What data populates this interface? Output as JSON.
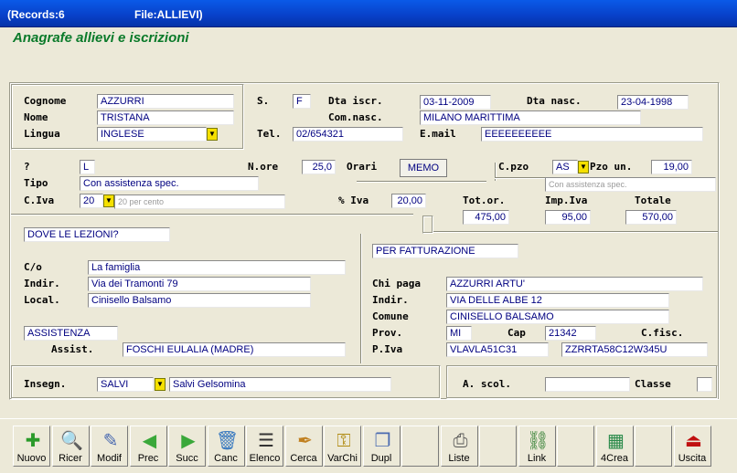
{
  "titlebar": {
    "records": "(Records:6",
    "file": "File:ALLIEVI)"
  },
  "form": {
    "title": "Anagrafe allievi e iscrizioni"
  },
  "labels": {
    "cognome": "Cognome",
    "nome": "Nome",
    "lingua": "Lingua",
    "s": "S.",
    "dta_iscr": "Dta iscr.",
    "dta_nasc": "Dta nasc.",
    "com_nasc": "Com.nasc.",
    "tel": "Tel.",
    "email": "E.mail",
    "q": "?",
    "n_ore": "N.ore",
    "orari": "Orari",
    "c_pzo": "C.pzo",
    "pzo_un": "Pzo un.",
    "tipo": "Tipo",
    "c_iva": "C.Iva",
    "perc_iva": "% Iva",
    "tot_or": "Tot.or.",
    "imp_iva": "Imp.Iva",
    "totale": "Totale",
    "co": "C/o",
    "indir": "Indir.",
    "local": "Local.",
    "assist": "Assist.",
    "chi_paga": "Chi paga",
    "indir2": "Indir.",
    "comune": "Comune",
    "prov": "Prov.",
    "cap": "Cap",
    "c_fisc": "C.fisc.",
    "p_iva": "P.Iva",
    "insegn": "Insegn.",
    "a_scol": "A. scol.",
    "classe": "Classe"
  },
  "values": {
    "cognome": "AZZURRI",
    "nome": "TRISTANA",
    "lingua": "INGLESE",
    "sesso": "F",
    "dta_iscr": "03-11-2009",
    "dta_nasc": "23-04-1998",
    "com_nasc": "MILANO MARITTIMA",
    "tel": "02/654321",
    "email": "EEEEEEEEEE",
    "q": "L",
    "n_ore": "25,0",
    "c_pzo": "AS",
    "pzo_un": "19,00",
    "pzo_desc": "Con assistenza spec.",
    "tipo": "Con assistenza spec.",
    "c_iva": "20",
    "c_iva_desc": "20 per cento",
    "perc_iva": "20,00",
    "tot_or": "475,00",
    "imp_iva": "95,00",
    "totale": "570,00",
    "dove_lezioni": "DOVE LE LEZIONI?",
    "co": "La famiglia",
    "indir": "Via dei Tramonti 79",
    "local": "Cinisello Balsamo",
    "assistenza": "ASSISTENZA",
    "assist": "FOSCHI EULALIA (MADRE)",
    "per_fatt": "PER FATTURAZIONE",
    "chi_paga": "AZZURRI ARTU'",
    "indir2": "VIA DELLE ALBE 12",
    "comune": "CINISELLO BALSAMO",
    "prov": "MI",
    "cap": "21342",
    "p_iva": "VLAVLA51C31",
    "c_fisc": "ZZRRTA58C12W345U",
    "insegn": "SALVI",
    "insegn_name": "Salvi Gelsomina",
    "a_scol": "",
    "classe": ""
  },
  "buttons": {
    "memo": "MEMO"
  },
  "toolbar": [
    {
      "label": "Nuovo",
      "icon": "new-icon"
    },
    {
      "label": "Ricer",
      "icon": "search-icon"
    },
    {
      "label": "Modif",
      "icon": "edit-icon"
    },
    {
      "label": "Prec",
      "icon": "arrow-left-icon"
    },
    {
      "label": "Succ",
      "icon": "arrow-right-icon"
    },
    {
      "label": "Canc",
      "icon": "trash-icon"
    },
    {
      "label": "Elenco",
      "icon": "list-icon"
    },
    {
      "label": "Cerca",
      "icon": "find-icon"
    },
    {
      "label": "VarChi",
      "icon": "keys-icon"
    },
    {
      "label": "Dupl",
      "icon": "duplicate-icon"
    },
    {
      "label": "",
      "icon": ""
    },
    {
      "label": "Liste",
      "icon": "printer-icon"
    },
    {
      "label": "",
      "icon": ""
    },
    {
      "label": "Link",
      "icon": "link-icon"
    },
    {
      "label": "",
      "icon": ""
    },
    {
      "label": "4Crea",
      "icon": "create-icon"
    },
    {
      "label": "",
      "icon": ""
    },
    {
      "label": "Uscita",
      "icon": "exit-icon"
    }
  ]
}
